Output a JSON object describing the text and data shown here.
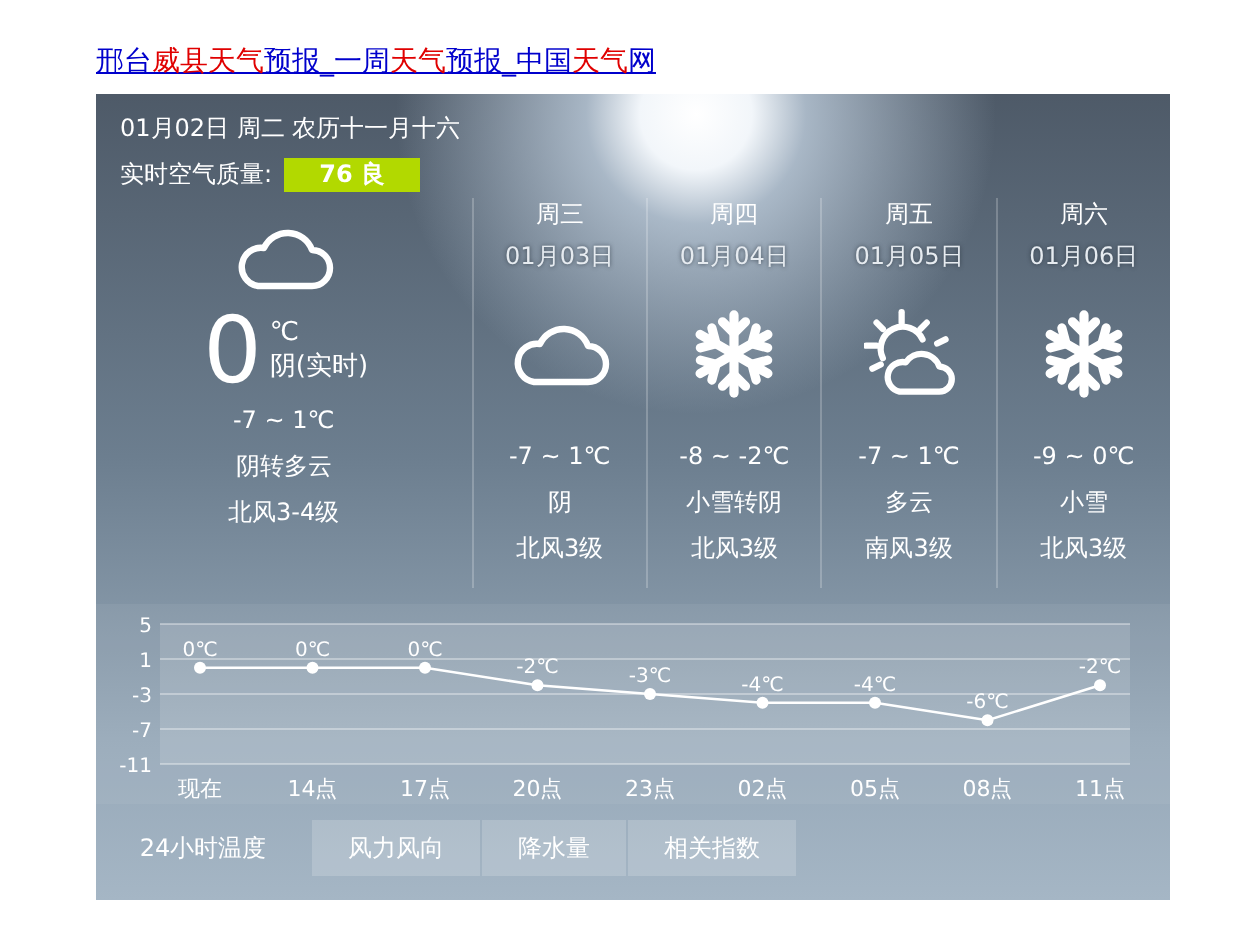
{
  "title_link": {
    "segments": [
      {
        "text": "邢台",
        "highlight": false
      },
      {
        "text": "威县天气",
        "highlight": true
      },
      {
        "text": "预报_一周",
        "highlight": false
      },
      {
        "text": "天气",
        "highlight": true
      },
      {
        "text": "预报_中国",
        "highlight": false
      },
      {
        "text": "天气",
        "highlight": true
      },
      {
        "text": "网",
        "highlight": false
      }
    ]
  },
  "header": {
    "date_line": "01月02日 周二 农历十一月十六",
    "aqi_label": "实时空气质量:",
    "aqi_value": "76 良"
  },
  "today": {
    "kind": "cloudy",
    "temperature": "0",
    "unit": "℃",
    "condition": "阴(实时)",
    "range": "-7 ~ 1℃",
    "weather": "阴转多云",
    "wind": "北风3-4级"
  },
  "days": [
    {
      "weekday": "周三",
      "date": "01月03日",
      "kind": "cloudy",
      "range": "-7 ~ 1℃",
      "weather": "阴",
      "wind": "北风3级"
    },
    {
      "weekday": "周四",
      "date": "01月04日",
      "kind": "snow",
      "range": "-8 ~ -2℃",
      "weather": "小雪转阴",
      "wind": "北风3级"
    },
    {
      "weekday": "周五",
      "date": "01月05日",
      "kind": "partly_cloudy",
      "range": "-7 ~ 1℃",
      "weather": "多云",
      "wind": "南风3级"
    },
    {
      "weekday": "周六",
      "date": "01月06日",
      "kind": "snow",
      "range": "-9 ~ 0℃",
      "weather": "小雪",
      "wind": "北风3级"
    }
  ],
  "chart": {
    "chart_data": {
      "type": "line",
      "categories": [
        "现在",
        "14点",
        "17点",
        "20点",
        "23点",
        "02点",
        "05点",
        "08点",
        "11点"
      ],
      "series": [
        {
          "color": "#ffffff",
          "marker": "circle",
          "values": [
            0,
            0,
            0,
            -2,
            -3,
            -4,
            -4,
            -6,
            -2
          ]
        }
      ],
      "grid": true,
      "yticks": [
        5,
        1,
        -3,
        -7,
        -11
      ],
      "ylim": [
        -11,
        5
      ],
      "value_labels": [
        "0℃",
        "0℃",
        "0℃",
        "-2℃",
        "-3℃",
        "-4℃",
        "-4℃",
        "-6℃",
        "-2℃"
      ]
    }
  },
  "chart_tabs": [
    {
      "label": "24小时温度",
      "selected": true
    },
    {
      "label": "风力风向",
      "selected": false
    },
    {
      "label": "降水量",
      "selected": false
    },
    {
      "label": "相关指数",
      "selected": false
    }
  ]
}
